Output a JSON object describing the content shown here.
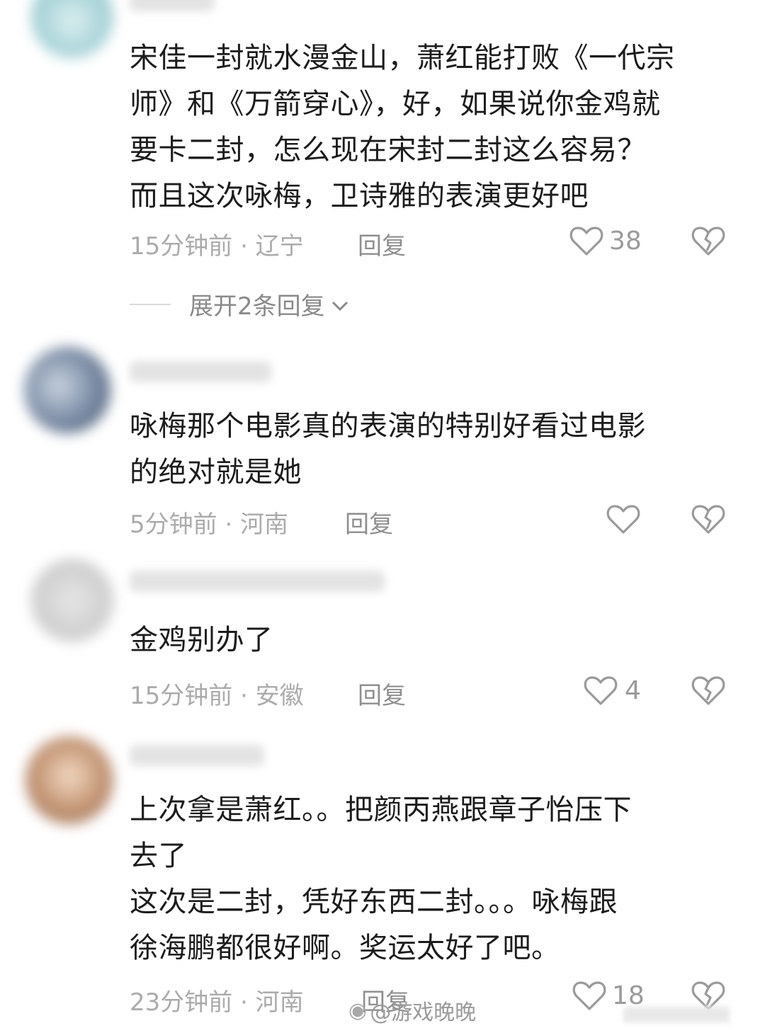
{
  "comments": [
    {
      "text": "宋佳一封就水漫金山，萧红能打败《一代宗\n师》和《万箭穿心》，好，如果说你金鸡就\n要卡二封，怎么现在宋封二封这么容易？\n而且这次咏梅，卫诗雅的表演更好吧",
      "time": "15分钟前 · 辽宁",
      "reply": "回复",
      "likes": "38"
    },
    {
      "text": "咏梅那个电影真的表演的特别好看过电影\n的绝对就是她",
      "time": "5分钟前 · 河南",
      "reply": "回复",
      "likes": ""
    },
    {
      "text": "金鸡别办了",
      "time": "15分钟前 · 安徽",
      "reply": "回复",
      "likes": "4"
    },
    {
      "text": "上次拿是萧红。。把颜丙燕跟章子怡压下\n去了\n这次是二封，凭好东西二封。。。咏梅跟\n徐海鹏都很好啊。奖运太好了吧。",
      "time": "23分钟前 · 河南",
      "reply": "回复",
      "likes": "18"
    }
  ],
  "expand_replies": "展开2条回复",
  "watermark": "@游戏晚晚",
  "icons": {
    "like": "heart-outline-icon",
    "dislike": "broken-heart-icon",
    "expand": "chevron-down-icon"
  },
  "colors": {
    "text": "#1c1c1c",
    "meta": "#ababab",
    "icon": "#9a9a9a"
  }
}
